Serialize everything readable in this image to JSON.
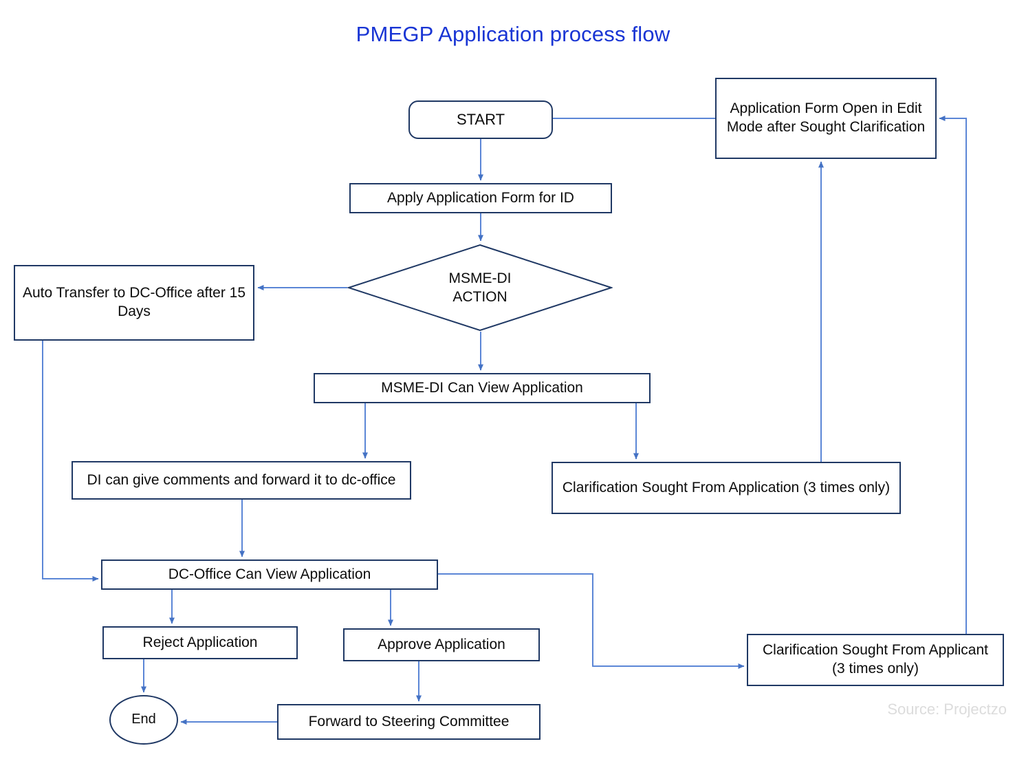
{
  "title": "PMEGP Application process flow",
  "source_note": "Source: Projectzo",
  "colors": {
    "title": "#1935d4",
    "node_border": "#1f3864",
    "edge": "#5b86d6",
    "text": "#0c0c0c",
    "source_text": "#dcdcdc",
    "background": "#ffffff"
  },
  "nodes": {
    "start": "START",
    "apply": "Apply Application Form for ID",
    "edit_mode": "Application Form Open in Edit Mode after Sought Clarification",
    "decision": "MSME-DI\nACTION",
    "decision_line1": "MSME-DI",
    "decision_line2": "ACTION",
    "auto_transfer": "Auto Transfer to DC-Office after 15 Days",
    "msme_can_view": "MSME-DI Can View Application",
    "di_comments": "DI can give comments and forward it to dc-office",
    "clarification_application": "Clarification Sought From Application (3 times only)",
    "dc_office_can_view": "DC-Office Can View Application",
    "reject": "Reject Application",
    "approve": "Approve Application",
    "clarification_applicant": "Clarification Sought From Applicant (3 times only)",
    "forward_steering": "Forward to Steering Committee",
    "end": "End"
  },
  "chart_data": {
    "type": "diagram",
    "diagram_kind": "flowchart",
    "title": "PMEGP Application process flow",
    "shapes": [
      {
        "id": "start",
        "shape": "rounded-rectangle",
        "label": "START"
      },
      {
        "id": "apply",
        "shape": "rectangle",
        "label": "Apply Application Form for ID"
      },
      {
        "id": "decision",
        "shape": "diamond",
        "label": "MSME-DI ACTION"
      },
      {
        "id": "auto_transfer",
        "shape": "rectangle",
        "label": "Auto Transfer to DC-Office after 15 Days"
      },
      {
        "id": "msme_can_view",
        "shape": "rectangle",
        "label": "MSME-DI Can View Application"
      },
      {
        "id": "di_comments",
        "shape": "rectangle",
        "label": "DI can give comments and forward it to dc-office"
      },
      {
        "id": "clarification_application",
        "shape": "rectangle",
        "label": "Clarification Sought From Application (3 times only)"
      },
      {
        "id": "edit_mode",
        "shape": "rectangle",
        "label": "Application Form Open in Edit Mode after Sought Clarification"
      },
      {
        "id": "dc_office_can_view",
        "shape": "rectangle",
        "label": "DC-Office Can View Application"
      },
      {
        "id": "reject",
        "shape": "rectangle",
        "label": "Reject Application"
      },
      {
        "id": "approve",
        "shape": "rectangle",
        "label": "Approve Application"
      },
      {
        "id": "clarification_applicant",
        "shape": "rectangle",
        "label": "Clarification Sought From Applicant (3 times only)"
      },
      {
        "id": "forward_steering",
        "shape": "rectangle",
        "label": "Forward to Steering Committee"
      },
      {
        "id": "end",
        "shape": "ellipse",
        "label": "End"
      }
    ],
    "edges": [
      {
        "from": "start",
        "to": "apply"
      },
      {
        "from": "apply",
        "to": "decision"
      },
      {
        "from": "decision",
        "to": "auto_transfer"
      },
      {
        "from": "decision",
        "to": "msme_can_view"
      },
      {
        "from": "msme_can_view",
        "to": "di_comments"
      },
      {
        "from": "msme_can_view",
        "to": "clarification_application"
      },
      {
        "from": "clarification_application",
        "to": "edit_mode"
      },
      {
        "from": "edit_mode",
        "to": "apply"
      },
      {
        "from": "di_comments",
        "to": "dc_office_can_view"
      },
      {
        "from": "auto_transfer",
        "to": "dc_office_can_view"
      },
      {
        "from": "dc_office_can_view",
        "to": "reject"
      },
      {
        "from": "dc_office_can_view",
        "to": "approve"
      },
      {
        "from": "dc_office_can_view",
        "to": "clarification_applicant"
      },
      {
        "from": "clarification_applicant",
        "to": "edit_mode"
      },
      {
        "from": "reject",
        "to": "end"
      },
      {
        "from": "approve",
        "to": "forward_steering"
      },
      {
        "from": "forward_steering",
        "to": "end"
      }
    ]
  }
}
